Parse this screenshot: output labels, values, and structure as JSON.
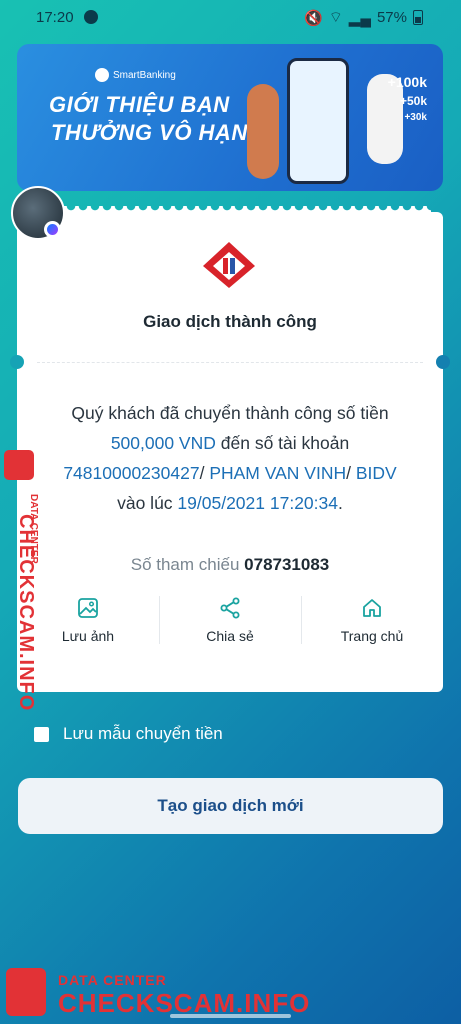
{
  "status_bar": {
    "time": "17:20",
    "battery": "57%"
  },
  "banner": {
    "brand": "SmartBanking",
    "line1": "GIỚI THIỆU BẠN",
    "line2": "THƯỞNG VÔ HẠN",
    "bonus": [
      "+100k",
      "+50k",
      "+30k"
    ]
  },
  "receipt": {
    "title": "Giao dịch thành công",
    "message": {
      "p1": "Quý khách đã chuyển thành công số tiền ",
      "amount": "500,000 VND",
      "p2": " đến số tài khoản ",
      "account": "74810000230427",
      "sep1": "/ ",
      "name": "PHAM VAN VINH",
      "sep2": "/ ",
      "bank": "BIDV",
      "p3": " vào lúc ",
      "datetime": "19/05/2021 17:20:34",
      "end": "."
    },
    "ref_label": "Số tham chiếu",
    "ref_number": "078731083",
    "actions": [
      {
        "label": "Lưu ảnh",
        "icon": "image-icon"
      },
      {
        "label": "Chia sẻ",
        "icon": "share-icon"
      },
      {
        "label": "Trang chủ",
        "icon": "home-icon"
      }
    ]
  },
  "save_template": {
    "label": "Lưu mẫu chuyển tiền",
    "checked": false
  },
  "new_transaction_button": "Tạo giao dịch mới",
  "watermark": {
    "side_small": "DATA CENTER",
    "side_big": "CHECKSCAM.INFO",
    "bottom_small": "DATA CENTER",
    "bottom_big": "CHECKSCAM.INFO",
    "color": "#e23236"
  },
  "colors": {
    "accent": "#1c6fb6",
    "bg_start": "#18c1b3",
    "bg_end": "#0d5fa4"
  }
}
